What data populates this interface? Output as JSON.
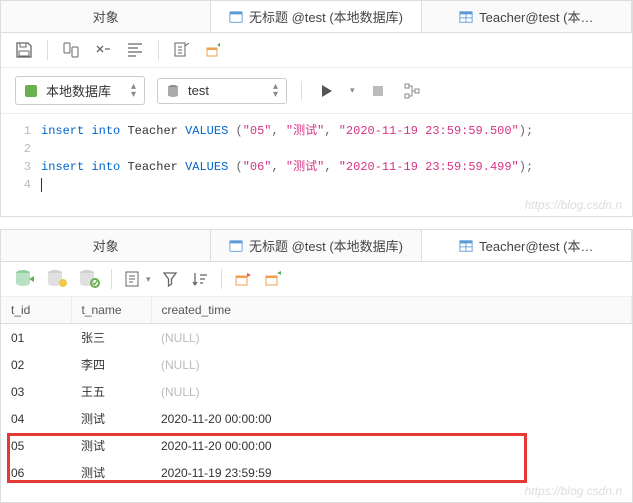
{
  "top_pane": {
    "tabs": [
      {
        "label": "对象",
        "icon": null,
        "active": false
      },
      {
        "label": "无标题 @test (本地数据库)",
        "icon": "query-icon",
        "active": true
      },
      {
        "label": "Teacher@test (本…",
        "icon": "table-icon",
        "active": false
      }
    ],
    "db_select": {
      "label": "本地数据库"
    },
    "schema_select": {
      "label": "test"
    }
  },
  "sql": {
    "lines": [
      "1",
      "2",
      "3",
      "4"
    ],
    "line1": {
      "kw1": "insert",
      "kw2": "into",
      "ident": "Teacher",
      "kw3": "VALUES",
      "v1": "\"05\"",
      "v2": "\"测试\"",
      "v3": "\"2020-11-19 23:59:59.500\""
    },
    "line3": {
      "kw1": "insert",
      "kw2": "into",
      "ident": "Teacher",
      "kw3": "VALUES",
      "v1": "\"06\"",
      "v2": "\"测试\"",
      "v3": "\"2020-11-19 23:59:59.499\""
    }
  },
  "bottom_pane": {
    "tabs": [
      {
        "label": "对象",
        "icon": null,
        "active": false
      },
      {
        "label": "无标题 @test (本地数据库)",
        "icon": "query-icon",
        "active": false
      },
      {
        "label": "Teacher@test (本…",
        "icon": "table-icon",
        "active": true
      }
    ]
  },
  "table": {
    "columns": [
      "t_id",
      "t_name",
      "created_time"
    ],
    "rows": [
      {
        "t_id": "01",
        "t_name": "张三",
        "created_time": "(NULL)",
        "null": true
      },
      {
        "t_id": "02",
        "t_name": "李四",
        "created_time": "(NULL)",
        "null": true
      },
      {
        "t_id": "03",
        "t_name": "王五",
        "created_time": "(NULL)",
        "null": true
      },
      {
        "t_id": "04",
        "t_name": "测试",
        "created_time": "2020-11-20 00:00:00",
        "null": false
      },
      {
        "t_id": "05",
        "t_name": "测试",
        "created_time": "2020-11-20 00:00:00",
        "null": false
      },
      {
        "t_id": "06",
        "t_name": "测试",
        "created_time": "2020-11-19 23:59:59",
        "null": false
      }
    ]
  },
  "watermark": "https://blog.csdn.n"
}
